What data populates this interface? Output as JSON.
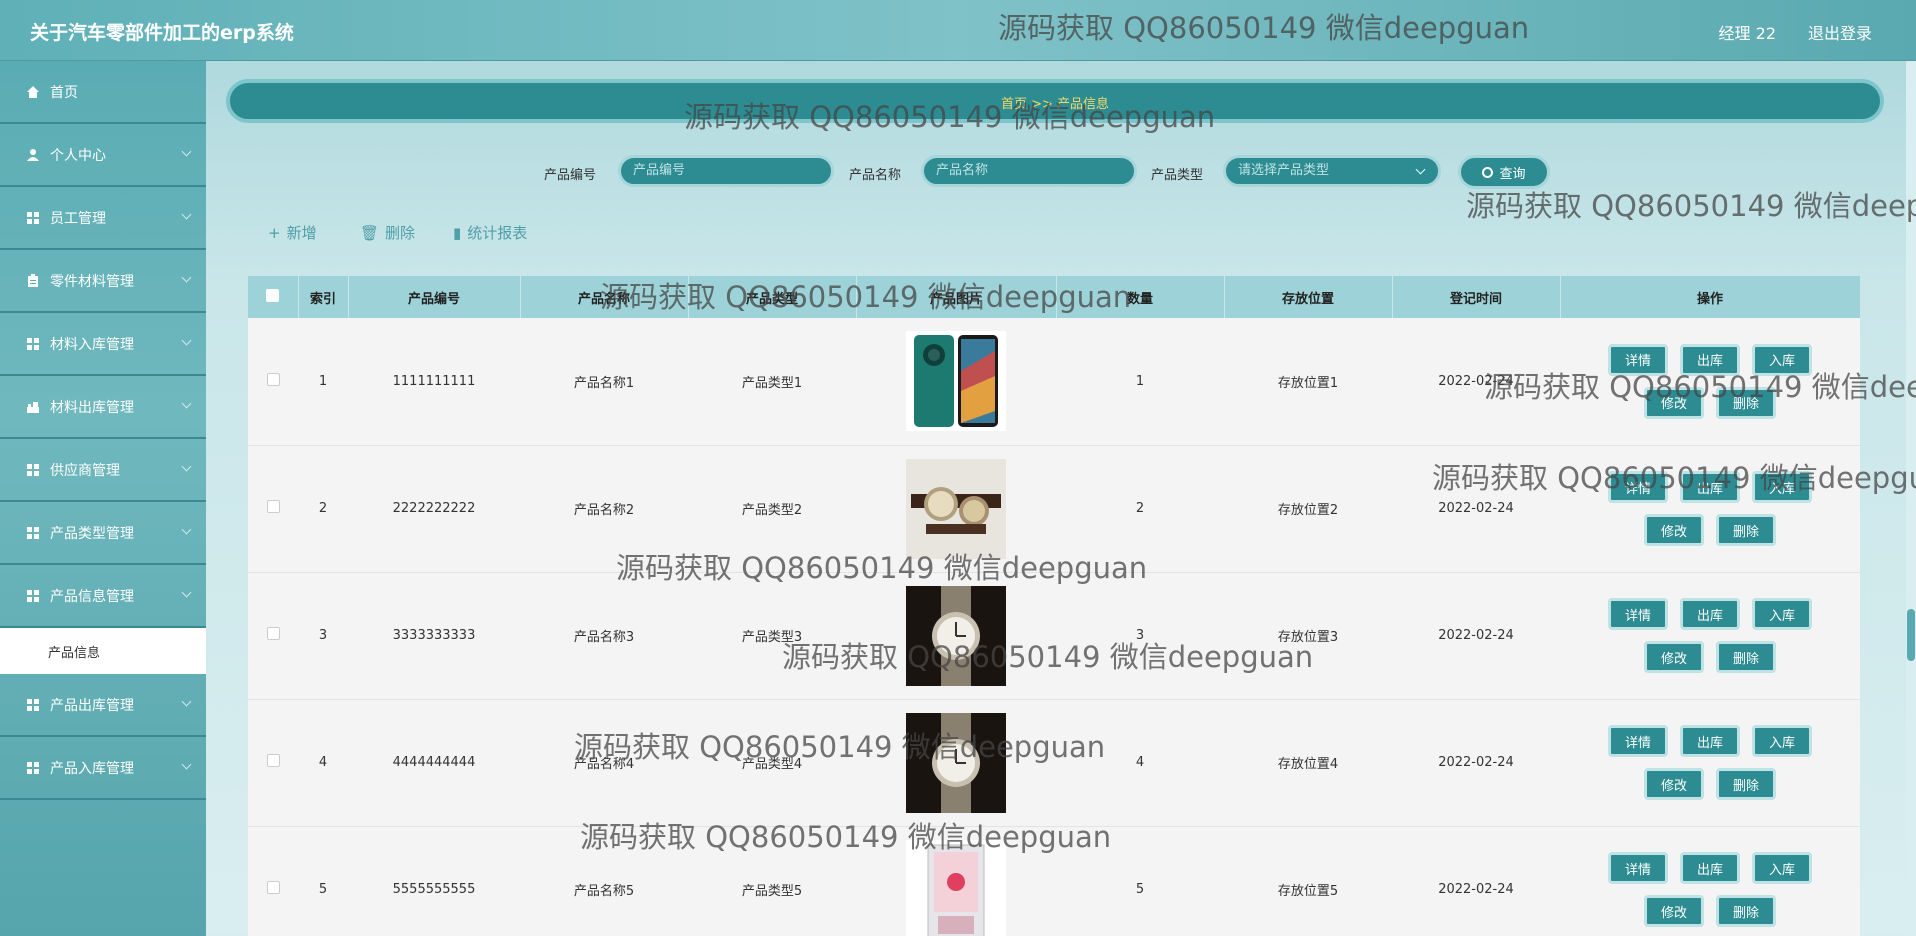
{
  "header": {
    "title": "关于汽车零部件加工的erp系统",
    "user": "经理 22",
    "logout": "退出登录"
  },
  "sidebar": {
    "items": [
      {
        "label": "首页",
        "icon": "home-icon",
        "chevron": false
      },
      {
        "label": "个人中心",
        "icon": "user-icon",
        "chevron": true
      },
      {
        "label": "员工管理",
        "icon": "grid-icon",
        "chevron": true
      },
      {
        "label": "零件材料管理",
        "icon": "clipboard-icon",
        "chevron": true
      },
      {
        "label": "材料入库管理",
        "icon": "grid-icon",
        "chevron": true
      },
      {
        "label": "材料出库管理",
        "icon": "building-icon",
        "chevron": true
      },
      {
        "label": "供应商管理",
        "icon": "grid-icon",
        "chevron": true
      },
      {
        "label": "产品类型管理",
        "icon": "grid-icon",
        "chevron": true
      },
      {
        "label": "产品信息管理",
        "icon": "grid-icon",
        "chevron": true
      }
    ],
    "sub_item": "产品信息",
    "items_after": [
      {
        "label": "产品出库管理",
        "icon": "grid-icon",
        "chevron": true
      },
      {
        "label": "产品入库管理",
        "icon": "grid-icon",
        "chevron": true
      }
    ]
  },
  "breadcrumb": "首页 >> 产品信息",
  "search": {
    "code_label": "产品编号",
    "code_placeholder": "产品编号",
    "name_label": "产品名称",
    "name_placeholder": "产品名称",
    "type_label": "产品类型",
    "type_placeholder": "请选择产品类型",
    "query": "查询"
  },
  "toolbar": {
    "add": "新增",
    "delete": "删除",
    "report": "统计报表"
  },
  "table": {
    "columns": [
      "索引",
      "产品编号",
      "产品名称",
      "产品类型",
      "产品图片",
      "数量",
      "存放位置",
      "登记时间",
      "操作"
    ],
    "rows": [
      {
        "index": "1",
        "code": "1111111111",
        "name": "产品名称1",
        "type": "产品类型1",
        "qty": "1",
        "location": "存放位置1",
        "date": "2022-02-24",
        "image": "phone"
      },
      {
        "index": "2",
        "code": "2222222222",
        "name": "产品名称2",
        "type": "产品类型2",
        "qty": "2",
        "location": "存放位置2",
        "date": "2022-02-24",
        "image": "watches"
      },
      {
        "index": "3",
        "code": "3333333333",
        "name": "产品名称3",
        "type": "产品类型3",
        "qty": "3",
        "location": "存放位置3",
        "date": "2022-02-24",
        "image": "watch"
      },
      {
        "index": "4",
        "code": "4444444444",
        "name": "产品名称4",
        "type": "产品类型4",
        "qty": "4",
        "location": "存放位置4",
        "date": "2022-02-24",
        "image": "watch"
      },
      {
        "index": "5",
        "code": "5555555555",
        "name": "产品名称5",
        "type": "产品类型5",
        "qty": "5",
        "location": "存放位置5",
        "date": "2022-02-24",
        "image": "pc-case"
      }
    ],
    "ops": {
      "detail": "详情",
      "out": "出库",
      "in": "入库",
      "edit": "修改",
      "remove": "删除"
    }
  },
  "watermark": "源码获取 QQ86050149 微信deepguan",
  "colors": {
    "accent": "#2c8c92",
    "header": "#6fbcc2",
    "light": "#9dd3d8"
  }
}
